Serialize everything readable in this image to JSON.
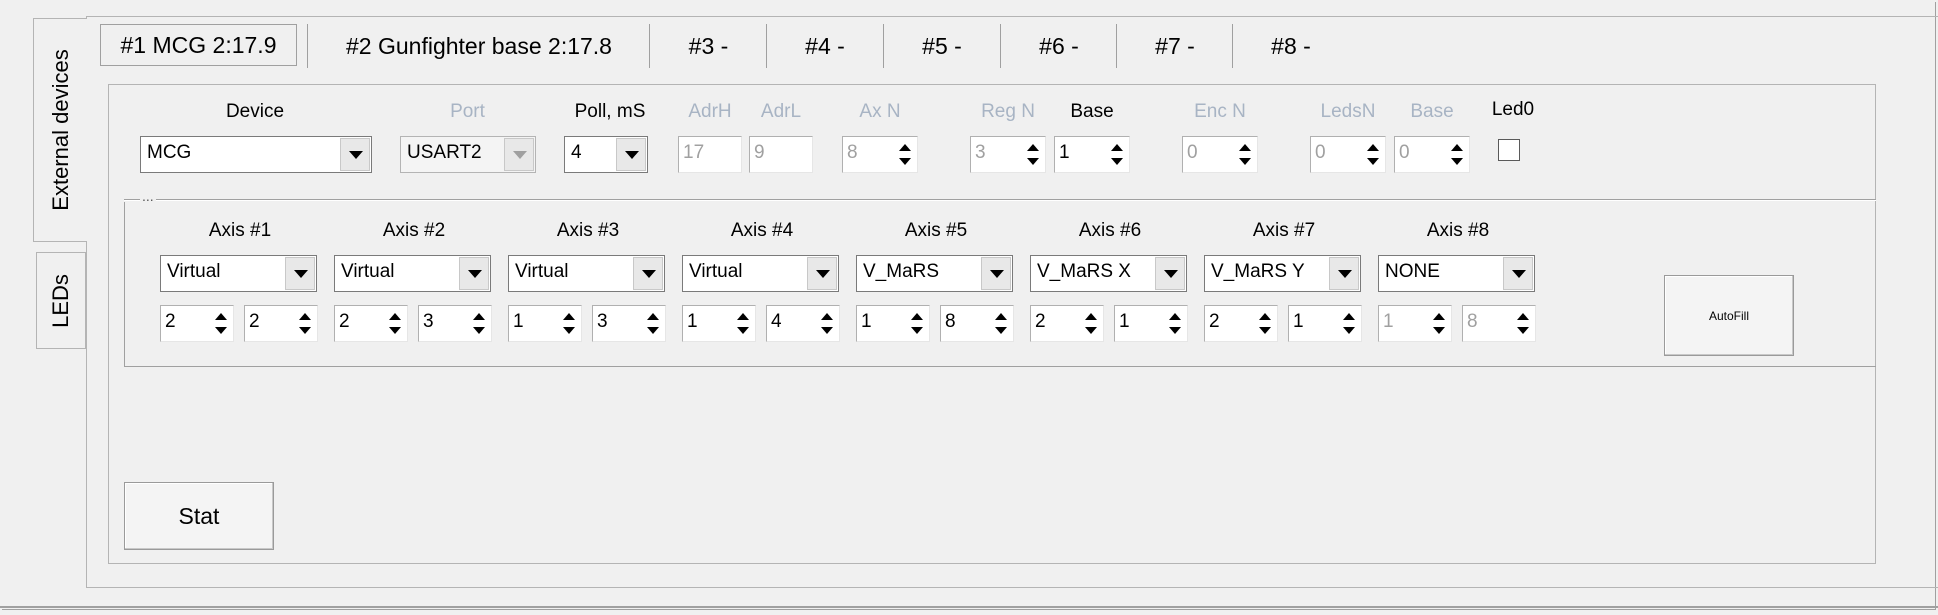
{
  "side_tabs": [
    "External devices",
    "LEDs"
  ],
  "top_tabs": [
    "#1 MCG 2:17.9",
    "#2 Gunfighter base 2:17.8",
    "#3 -",
    "#4 -",
    "#5 -",
    "#6 -",
    "#7 -",
    "#8 -"
  ],
  "device_row": {
    "device": {
      "label": "Device",
      "value": "MCG"
    },
    "port": {
      "label": "Port",
      "value": "USART2",
      "enabled": false
    },
    "poll": {
      "label": "Poll, mS",
      "value": "4"
    },
    "adrh": {
      "label": "AdrH",
      "value": "17",
      "enabled": false
    },
    "adrl": {
      "label": "AdrL",
      "value": "9",
      "enabled": false
    },
    "axn": {
      "label": "Ax N",
      "value": "8",
      "enabled": false
    },
    "regn": {
      "label": "Reg N",
      "value": "3",
      "enabled": false
    },
    "base": {
      "label": "Base",
      "value": "1"
    },
    "encn": {
      "label": "Enc N",
      "value": "0",
      "enabled": false
    },
    "ledsn": {
      "label": "LedsN",
      "value": "0",
      "enabled": false
    },
    "base2": {
      "label": "Base",
      "value": "0",
      "enabled": false
    },
    "led0": {
      "label": "Led0",
      "checked": false
    }
  },
  "axis_group_label": "...",
  "axes": [
    {
      "label": "Axis #1",
      "source": "Virtual",
      "a": "2",
      "b": "2"
    },
    {
      "label": "Axis #2",
      "source": "Virtual",
      "a": "2",
      "b": "3"
    },
    {
      "label": "Axis #3",
      "source": "Virtual",
      "a": "1",
      "b": "3"
    },
    {
      "label": "Axis #4",
      "source": "Virtual",
      "a": "1",
      "b": "4"
    },
    {
      "label": "Axis #5",
      "source": "V_MaRS",
      "a": "1",
      "b": "8"
    },
    {
      "label": "Axis #6",
      "source": "V_MaRS X",
      "a": "2",
      "b": "1"
    },
    {
      "label": "Axis #7",
      "source": "V_MaRS Y",
      "a": "2",
      "b": "1"
    },
    {
      "label": "Axis #8",
      "source": "NONE",
      "a": "1",
      "b": "8"
    }
  ],
  "buttons": {
    "autofill": "AutoFill",
    "stat": "Stat"
  }
}
